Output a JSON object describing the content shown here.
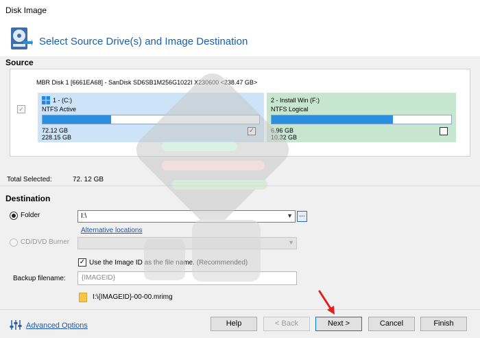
{
  "window": {
    "title": "Disk Image"
  },
  "header": {
    "title": "Select Source Drive(s) and Image Destination"
  },
  "source": {
    "section_label": "Source",
    "disk_label": "MBR Disk 1 [6661EA68] - SanDisk SD6SB1M256G1022I X230600  <238.47 GB>",
    "disk_checked": true,
    "partitions": [
      {
        "name": "1 - (C:)",
        "fs": "NTFS Active",
        "used": "72.12 GB",
        "total": "228.15 GB",
        "usage_fraction": 0.316,
        "checked": true,
        "icon": "windows-logo-icon",
        "color": "#cde3f7"
      },
      {
        "name": "2 - Install Win (F:)",
        "fs": "NTFS Logical",
        "used": "6.96 GB",
        "total": "10.32 GB",
        "usage_fraction": 0.674,
        "checked": false,
        "color": "#c7e6d0"
      }
    ],
    "total_label": "Total Selected:",
    "total_value": "72. 12 GB"
  },
  "destination": {
    "section_label": "Destination",
    "folder_label": "Folder",
    "folder_selected": true,
    "folder_value": "I:\\",
    "browse_label": "...",
    "alt_locations": "Alternative locations",
    "cd_label": "CD/DVD Burner",
    "cd_enabled": false,
    "use_image_id_label": "Use the Image ID as the file name.  (Recommended)",
    "use_image_id_checked": true,
    "backup_filename_label": "Backup filename:",
    "backup_filename_placeholder": "{IMAGEID}",
    "resulting_filename": "I:\\{IMAGEID}-00-00.mrimg"
  },
  "footer": {
    "advanced_options": "Advanced Options",
    "buttons": {
      "help": "Help",
      "back": "< Back",
      "next": "Next >",
      "cancel": "Cancel",
      "finish": "Finish"
    }
  },
  "colors": {
    "accent_blue": "#1b5ea8",
    "usage_fill": "#2b8fe0",
    "arrow_red": "#e0201c"
  }
}
